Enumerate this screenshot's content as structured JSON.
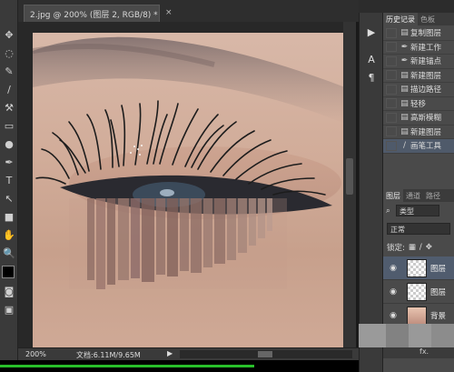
{
  "document": {
    "tab_title": "2.jpg @ 200% (图层 2, RGB/8) *",
    "close_label": "×"
  },
  "status": {
    "zoom": "200%",
    "doc_size": "文档:6.11M/9.65M",
    "arrow": "▶",
    "progress_fraction": 0.56
  },
  "toolbar": {
    "tools": [
      "move-icon",
      "lasso-icon",
      "quick-select-icon",
      "crop-icon",
      "eyedropper-icon",
      "healing-brush-icon",
      "brush-icon",
      "clone-stamp-icon",
      "history-brush-icon",
      "eraser-icon",
      "gradient-icon",
      "blur-icon",
      "dodge-icon",
      "pen-icon",
      "type-icon",
      "path-select-icon",
      "shape-icon",
      "hand-icon",
      "zoom-icon",
      "color-swatch-icon",
      "quick-mask-icon",
      "screen-mode-icon"
    ]
  },
  "mini_panel": {
    "buttons": [
      {
        "icon": "play-icon",
        "glyph": "▶"
      },
      {
        "icon": "character-icon",
        "glyph": "A"
      },
      {
        "icon": "paragraph-icon",
        "glyph": "¶"
      }
    ]
  },
  "history_panel": {
    "tabs": [
      "历史记录",
      "色板"
    ],
    "items": [
      {
        "label": "复制图层",
        "icon": "layer-icon"
      },
      {
        "label": "新建工作",
        "icon": "pen-icon"
      },
      {
        "label": "新建锚点",
        "icon": "pen-icon"
      },
      {
        "label": "新建图层",
        "icon": "layer-icon"
      },
      {
        "label": "描边路径",
        "icon": "layer-icon"
      },
      {
        "label": "轻移",
        "icon": "layer-icon"
      },
      {
        "label": "高斯模糊",
        "icon": "layer-icon"
      },
      {
        "label": "新建图层",
        "icon": "layer-icon"
      },
      {
        "label": "画笔工具",
        "icon": "brush-icon",
        "selected": true
      }
    ]
  },
  "layers_panel": {
    "tabs": [
      "图层",
      "通道",
      "路径"
    ],
    "filter_label": "类型",
    "blend_mode": "正常",
    "lock_label": "锁定:",
    "layers": [
      {
        "name": "图层",
        "thumb": "transparent",
        "selected": true
      },
      {
        "name": "图层",
        "thumb": "transparent",
        "selected": false
      },
      {
        "name": "背景",
        "thumb": "photo",
        "selected": false
      }
    ],
    "footer_label": "fx."
  }
}
